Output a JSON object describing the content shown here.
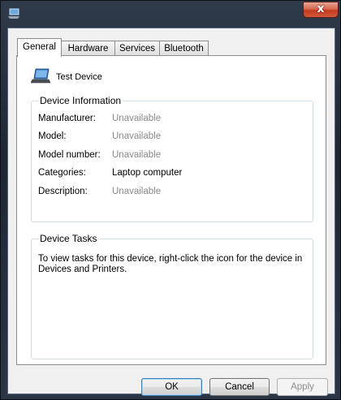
{
  "window": {
    "close_glyph": "x",
    "icon": "bluetooth-device-icon"
  },
  "tabs": [
    {
      "label": "General",
      "active": true
    },
    {
      "label": "Hardware",
      "active": false
    },
    {
      "label": "Services",
      "active": false
    },
    {
      "label": "Bluetooth",
      "active": false
    }
  ],
  "device": {
    "name": "Test Device",
    "icon": "laptop-icon"
  },
  "device_information": {
    "title": "Device Information",
    "rows": [
      {
        "label": "Manufacturer:",
        "value": "Unavailable",
        "muted": true
      },
      {
        "label": "Model:",
        "value": "Unavailable",
        "muted": true
      },
      {
        "label": "Model number:",
        "value": "Unavailable",
        "muted": true
      },
      {
        "label": "Categories:",
        "value": "Laptop computer",
        "muted": false
      },
      {
        "label": "Description:",
        "value": "Unavailable",
        "muted": true
      }
    ]
  },
  "device_tasks": {
    "title": "Device Tasks",
    "text": "To view tasks for this device, right-click the icon for the device in Devices and Printers."
  },
  "buttons": {
    "ok": "OK",
    "cancel": "Cancel",
    "apply": "Apply"
  },
  "colors": {
    "muted_text": "#8a8a8a",
    "close_button": "#c2391f",
    "frame": "#1e2633"
  }
}
